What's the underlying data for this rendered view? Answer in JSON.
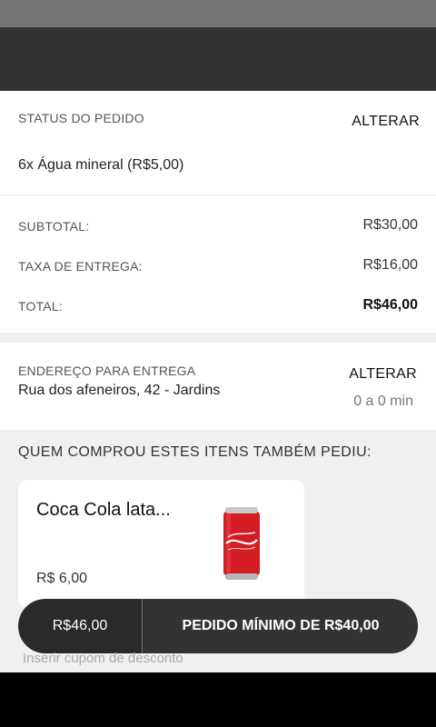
{
  "order": {
    "status_heading": "STATUS DO PEDIDO",
    "edit_label": "ALTERAR",
    "item": "6x Água mineral (R$5,00)"
  },
  "summary": {
    "subtotal_label": "SUBTOTAL:",
    "subtotal_value": "R$30,00",
    "fee_label": "TAXA DE ENTREGA:",
    "fee_value": "R$16,00",
    "total_label": "TOTAL:",
    "total_value": "R$46,00"
  },
  "address": {
    "heading": "ENDEREÇO PARA ENTREGA",
    "edit_label": "ALTERAR",
    "line": "Rua dos afeneiros, 42 - Jardins",
    "eta": "0 a 0 min"
  },
  "recommendations": {
    "title": "QUEM COMPROU ESTES ITENS TAMBÉM PEDIU:",
    "items": [
      {
        "name": "Coca Cola lata...",
        "price": "R$ 6,00",
        "image": "coca-cola-can"
      }
    ]
  },
  "checkout": {
    "total": "R$46,00",
    "minimum": "PEDIDO MÍNIMO DE R$40,00"
  },
  "coupon": {
    "placeholder": "Inserir cupom de desconto"
  },
  "colors": {
    "status_bar": "#757575",
    "app_bar": "#333333",
    "checkout_bar": "#2a2a2a",
    "can_red": "#d31d24"
  }
}
